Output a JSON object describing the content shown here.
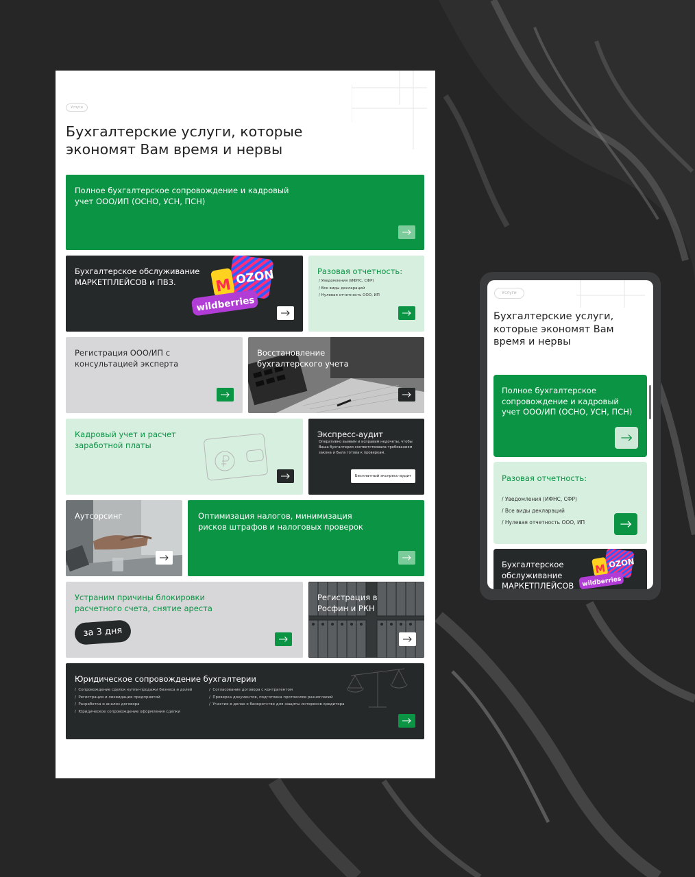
{
  "desktop": {
    "tag": "Услуги",
    "title": "Бухгалтерские услуги, которые экономят Вам время и нервы",
    "cards": {
      "full_support": "Полное бухгалтерское сопровождение и кадровый учет ООО/ИП (ОСНО, УСН, ПСН)",
      "marketplaces": "Бухгалтерское обслуживание МАРКЕТПЛЕЙСОВ и ПВЗ.",
      "one_time": {
        "title": "Разовая отчетность:",
        "items": [
          "Уведомления (ИФНС, СФР)",
          "Все виды деклараций",
          "Нулевая отчетность ООО, ИП"
        ]
      },
      "registration": "Регистрация ООО/ИП с консультацией эксперта",
      "restoration": "Восстановление бухгалтерского учета",
      "hr": "Кадровый учет и расчет заработной платы",
      "audit": {
        "title": "Экспресс-аудит",
        "text": "Оперативно выявим и исправим недочеты, чтобы Ваша бухгалтерия соответствовала требованиям закона и была готова к проверкам.",
        "button": "Бесплатный экспресс-аудит"
      },
      "outsourcing": "Аутсорсинг",
      "tax_optimization": "Оптимизация налогов, минимизация рисков штрафов и налоговых проверок",
      "unblock": {
        "title": "Устраним причины блокировки расчетного счета, снятие ареста",
        "badge": "за 3 дня"
      },
      "rosfin": "Регистрация в Росфин и РКН",
      "legal": {
        "title": "Юридическое сопровождение бухгалтерии",
        "col1": [
          "Сопровождение сделок купли-продажи бизнеса и долей",
          "Регистрация и ликвидация предприятий",
          "Разработка и анализ договора",
          "Юридическое сопровождение оформления сделки"
        ],
        "col2": [
          "Согласование договора с контрагентом",
          "Проверка документов, подготовка протоколов разногласий",
          "Участие в делах о банкротстве для защиты интересов кредитора"
        ]
      }
    },
    "logos": {
      "ozon": "OZON",
      "ozon_m": "M",
      "wildberries": "wildberries"
    }
  },
  "mobile": {
    "tag": "Услуги",
    "title": "Бухгалтерские услуги, которые экономят Вам время и нервы",
    "full_support": "Полное бухгалтерское сопровождение и кадровый учет ООО/ИП (ОСНО, УСН, ПСН)",
    "one_time": {
      "title": "Разовая отчетность:",
      "items": [
        "/ Уведомления (ИФНС, СФР)",
        "/ Все виды деклараций",
        "/ Нулевая отчетность ООО, ИП"
      ]
    },
    "marketplaces": "Бухгалтерское обслуживание МАРКЕТПЛЕЙСОВ"
  },
  "colors": {
    "green": "#0b9444",
    "dark": "#26292a",
    "mint": "#d7efdf",
    "grey": "#d7d7d9",
    "background": "#262626"
  }
}
